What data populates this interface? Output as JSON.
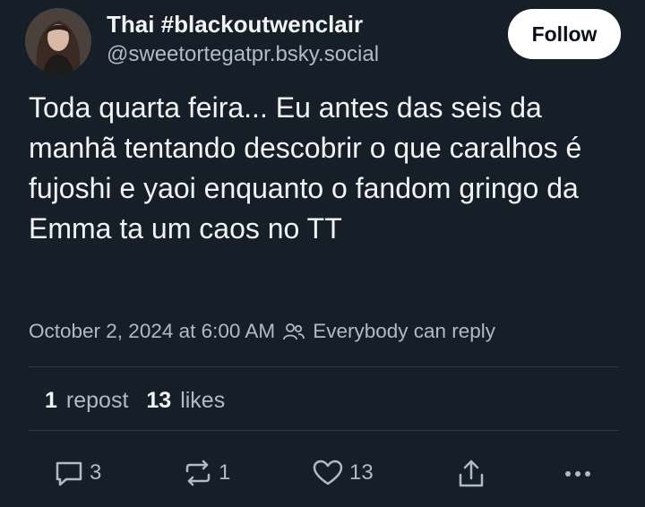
{
  "author": {
    "display_name": "Thai #blackoutwenclair",
    "handle": "@sweetortegatpr.bsky.social"
  },
  "follow_label": "Follow",
  "post": {
    "text": "Toda quarta feira... Eu antes das seis da manhã tentando descobrir o que caralhos é fujoshi e yaoi enquanto o fandom gringo da Emma ta um caos no TT",
    "timestamp": "October 2, 2024 at 6:00 AM",
    "reply_setting": "Everybody can reply"
  },
  "stats": {
    "reposts_count": "1",
    "reposts_label": "repost",
    "likes_count": "13",
    "likes_label": "likes"
  },
  "actions": {
    "reply_count": "3",
    "repost_count": "1",
    "like_count": "13"
  },
  "icons": [
    "avatar-photo",
    "people-icon",
    "reply-icon",
    "repost-icon",
    "like-icon",
    "share-icon",
    "more-icon"
  ],
  "colors": {
    "background": "#161e27",
    "text": "#f1f3f5",
    "muted": "#aebbc9",
    "divider": "#2e3b48",
    "follow_button": "#ffffff"
  }
}
